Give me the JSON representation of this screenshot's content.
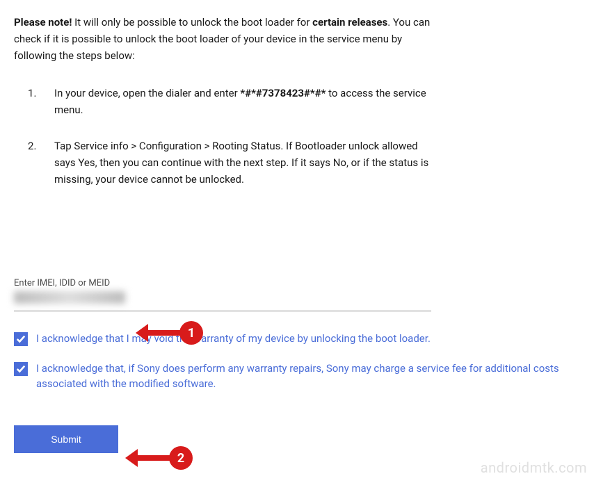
{
  "notice": {
    "bold_prefix": "Please note!",
    "text_1": " It will only be possible to unlock the boot loader for ",
    "bold_releases": "certain releases",
    "text_2": ". You can check if it is possible to unlock the boot loader of your device in the service menu by following the steps below:"
  },
  "steps": [
    {
      "pre": "In your device, open the dialer and enter ",
      "code": "*#*#7378423#*#*",
      "post": " to access the service menu."
    },
    {
      "text": "Tap Service info > Configuration > Rooting Status. If Bootloader unlock allowed says Yes, then you can continue with the next step. If it says No, or if the status is missing, your device cannot be unlocked."
    }
  ],
  "form": {
    "imei_label": "Enter IMEI, IDID or MEID",
    "checkbox1_label": "I acknowledge that I may void the warranty of my device by unlocking the boot loader.",
    "checkbox2_label": "I acknowledge that, if Sony does perform any warranty repairs, Sony may charge a service fee for additional costs associated with the modified software.",
    "submit_label": "Submit"
  },
  "annotations": {
    "marker1": "1",
    "marker2": "2"
  },
  "watermark": "androidmtk.com"
}
